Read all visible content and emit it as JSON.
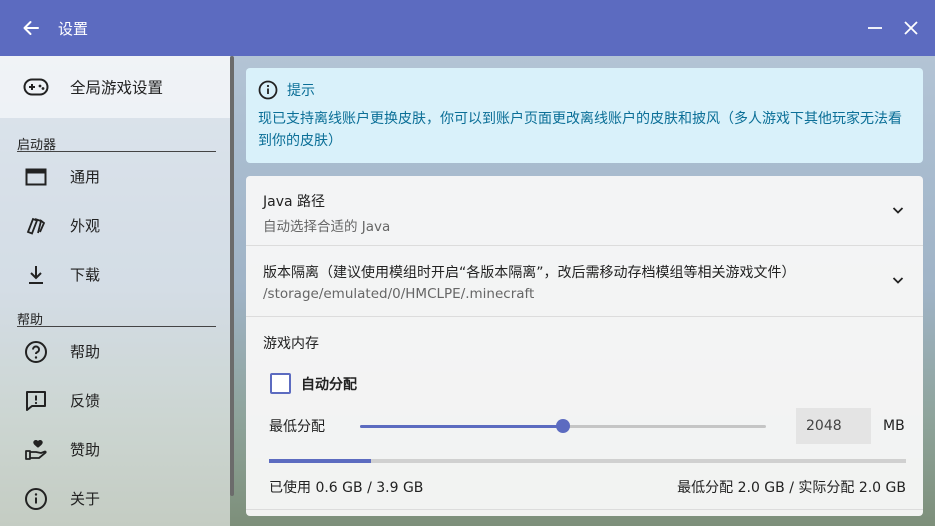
{
  "header": {
    "title": "设置",
    "bar_color": "#5c6bc0",
    "icons": {
      "back": "arrow-left-icon",
      "minimize": "minimize-icon",
      "close": "close-icon"
    }
  },
  "sidebar": {
    "global": {
      "label": "全局游戏设置",
      "icon": "gamepad-icon"
    },
    "sections": [
      {
        "title": "启动器",
        "items": [
          {
            "label": "通用",
            "icon": "window-icon"
          },
          {
            "label": "外观",
            "icon": "palette-icon"
          },
          {
            "label": "下载",
            "icon": "download-icon"
          }
        ]
      },
      {
        "title": "帮助",
        "items": [
          {
            "label": "帮助",
            "icon": "help-circle-icon"
          },
          {
            "label": "反馈",
            "icon": "feedback-icon"
          },
          {
            "label": "赞助",
            "icon": "donate-heart-icon"
          },
          {
            "label": "关于",
            "icon": "info-icon"
          }
        ]
      }
    ]
  },
  "notice": {
    "title": "提示",
    "body": "现已支持离线账户更换皮肤，你可以到账户页面更改离线账户的皮肤和披风（多人游戏下其他玩家无法看到你的皮肤）",
    "color": "#0b6f97",
    "background": "#d9f1fa"
  },
  "settings": {
    "java": {
      "title": "Java 路径",
      "value": "自动选择合适的 Java"
    },
    "isolation": {
      "title": "版本隔离（建议使用模组时开启“各版本隔离”，改后需移动存档模组等相关游戏文件）",
      "value": "/storage/emulated/0/HMCLPE/.minecraft"
    },
    "memory": {
      "title": "游戏内存",
      "auto_label": "自动分配",
      "auto_checked": false,
      "min_label": "最低分配",
      "min_value": "2048",
      "unit": "MB",
      "slider_fraction": 0.5,
      "usage_fraction": 0.16,
      "used_text": "已使用 0.6 GB / 3.9 GB",
      "alloc_text": "最低分配 2.0 GB / 实际分配 2.0 GB"
    }
  }
}
